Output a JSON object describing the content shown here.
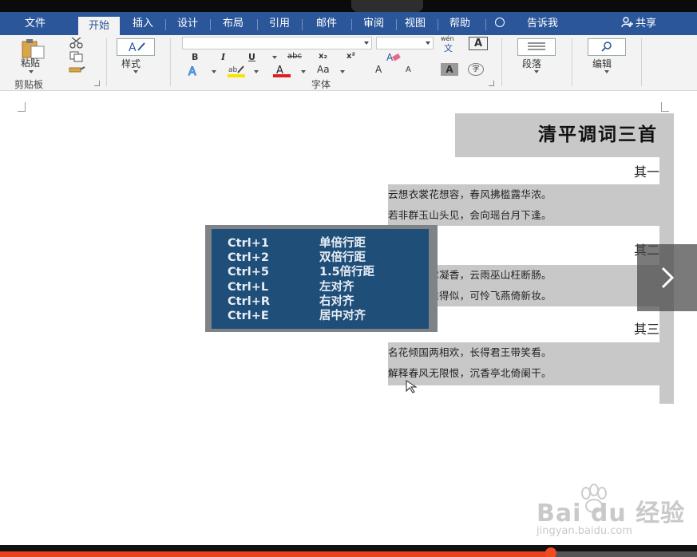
{
  "tabs": [
    {
      "label": "文件",
      "active": false
    },
    {
      "label": "开始",
      "active": true
    },
    {
      "label": "插入",
      "active": false
    },
    {
      "label": "设计",
      "active": false
    },
    {
      "label": "布局",
      "active": false
    },
    {
      "label": "引用",
      "active": false
    },
    {
      "label": "邮件",
      "active": false
    },
    {
      "label": "审阅",
      "active": false
    },
    {
      "label": "视图",
      "active": false
    },
    {
      "label": "帮助",
      "active": false
    }
  ],
  "tell_me": "告诉我",
  "share": "共享",
  "ribbon": {
    "paste": "粘贴",
    "clipboard_group": "剪贴板",
    "styles": "样式",
    "font_group": "字体",
    "paragraph": "段落",
    "editing": "编辑",
    "font_name": "",
    "font_size": "",
    "wen": "wén",
    "wen_char": "文",
    "bold": "B",
    "italic": "I",
    "underline": "U",
    "strike": "abc",
    "subscript": "x₂",
    "superscript": "x²",
    "case": "Aa",
    "grow": "A",
    "shrink": "A",
    "char_border": "A",
    "phonetic": "字"
  },
  "document": {
    "title": "清平调词三首",
    "poems": [
      {
        "heading": "其一",
        "lines": [
          "云想衣裳花想容，春风拂槛露华浓。",
          "若非群玉山头见，会向瑶台月下逢。"
        ]
      },
      {
        "heading": "其二",
        "lines": [
          "一枝红艳露凝香，云雨巫山枉断肠。",
          "借问汉宫谁得似，可怜飞燕倚新妆。"
        ]
      },
      {
        "heading": "其三",
        "lines": [
          "名花倾国两相欢，长得君王带笑看。",
          "解释春风无限恨，沉香亭北倚阑干。"
        ]
      }
    ]
  },
  "shortcuts": [
    {
      "keys": "Ctrl+1",
      "action": "单倍行距"
    },
    {
      "keys": "Ctrl+2",
      "action": "双倍行距"
    },
    {
      "keys": "Ctrl+5",
      "action": "1.5倍行距"
    },
    {
      "keys": "Ctrl+L",
      "action": "左对齐"
    },
    {
      "keys": "Ctrl+R",
      "action": "右对齐"
    },
    {
      "keys": "Ctrl+E",
      "action": "居中对齐"
    }
  ],
  "watermark": {
    "brand": "Bai du 经验",
    "url": "jingyan.baidu.com"
  },
  "video_progress": 0.79,
  "colors": {
    "ribbon_blue": "#2b579a",
    "popup_bg": "#1f4e79",
    "highlight_gray": "#c8c8c8",
    "progress_red": "#e8421f"
  }
}
